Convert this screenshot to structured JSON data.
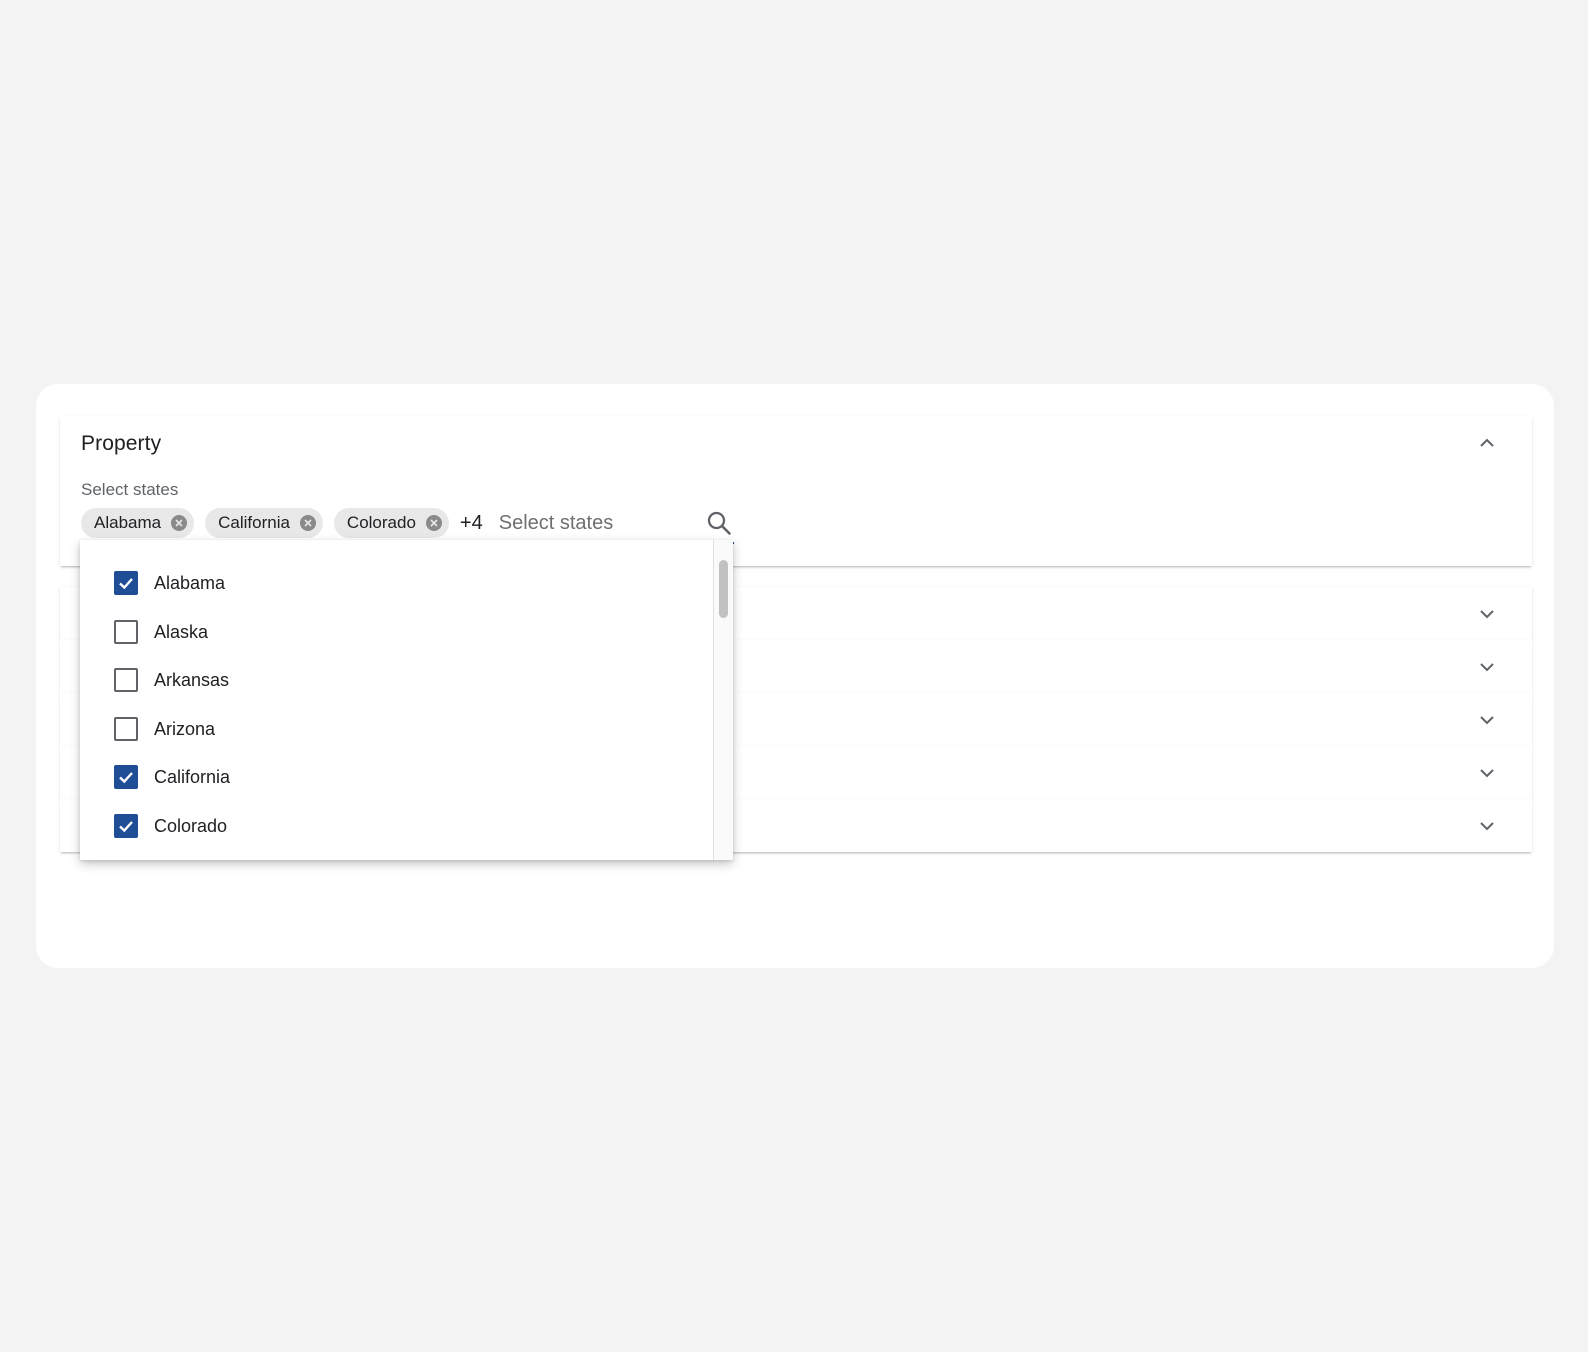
{
  "property_panel": {
    "title": "Property",
    "field_label": "Select states",
    "selected_chips": [
      {
        "label": "Alabama"
      },
      {
        "label": "California"
      },
      {
        "label": "Colorado"
      }
    ],
    "more_count": "+4",
    "input_placeholder": "Select states",
    "icons": {
      "collapse": "chevron-up-icon",
      "search": "search-icon",
      "chip_remove": "close-circle-icon"
    }
  },
  "collapsed_rows_icon": "chevron-down-icon",
  "dropdown": {
    "options": [
      {
        "label": "Alabama",
        "checked": true
      },
      {
        "label": "Alaska",
        "checked": false
      },
      {
        "label": "Arkansas",
        "checked": false
      },
      {
        "label": "Arizona",
        "checked": false
      },
      {
        "label": "California",
        "checked": true
      },
      {
        "label": "Colorado",
        "checked": true
      }
    ]
  },
  "colors": {
    "accent": "#1f4e96",
    "background": "#f3f3f3",
    "card": "#ffffff",
    "chip": "#e8e8e8"
  }
}
